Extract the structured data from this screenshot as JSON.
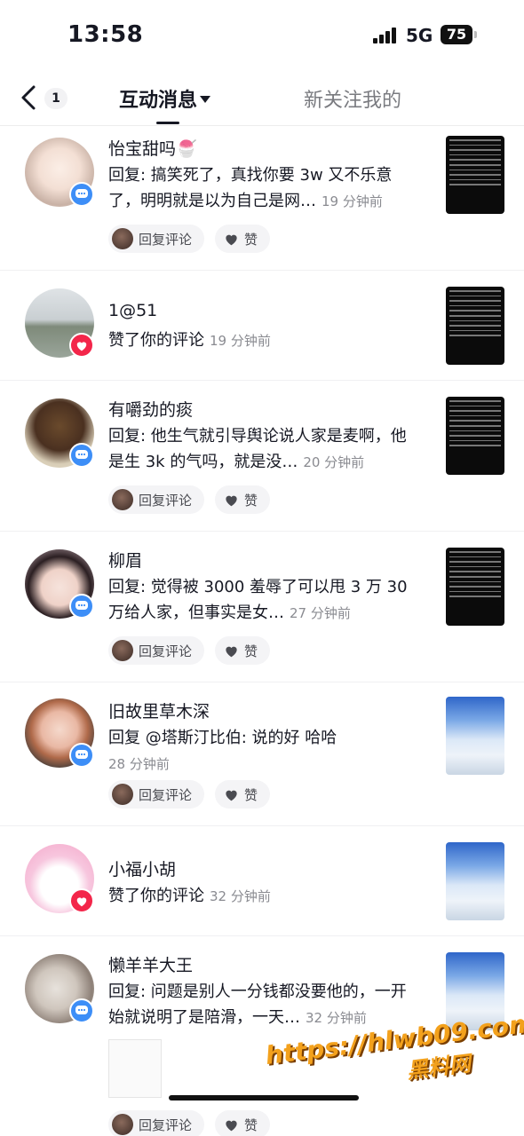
{
  "status": {
    "time": "13:58",
    "network": "5G",
    "battery": "75"
  },
  "header": {
    "back_count": "1",
    "tabs": [
      {
        "label": "互动消息"
      },
      {
        "label": "新关注我的"
      }
    ]
  },
  "feed": [
    {
      "name": "怡宝甜吗🍧",
      "badge": "comment-icon",
      "text": "回复: 搞笑死了，真找你要 3w 又不乐意了，明明就是以为自己是网…",
      "time": "19 分钟前",
      "reply_label": "回复评论",
      "like_label": "赞",
      "thumb": "black"
    },
    {
      "name": "1@51",
      "badge": "heart-icon",
      "text": "赞了你的评论",
      "time": "19 分钟前",
      "thumb": "black"
    },
    {
      "name": "有嚼劲的痰",
      "badge": "comment-icon",
      "text": "回复: 他生气就引导舆论说人家是麦啊，他是生 3k 的气吗，就是没…",
      "time": "20 分钟前",
      "reply_label": "回复评论",
      "like_label": "赞",
      "thumb": "black"
    },
    {
      "name": "柳眉",
      "badge": "comment-icon",
      "text": "回复: 觉得被 3000 羞辱了可以甩 3 万 30 万给人家，但事实是女…",
      "time": "27 分钟前",
      "reply_label": "回复评论",
      "like_label": "赞",
      "thumb": "black"
    },
    {
      "name": "旧故里草木深",
      "badge": "comment-icon",
      "text": "回复 @塔斯汀比伯: 说的好 哈哈",
      "time": "28 分钟前",
      "reply_label": "回复评论",
      "like_label": "赞",
      "thumb": "snow"
    },
    {
      "name": "小福小胡",
      "badge": "heart-icon",
      "text": "赞了你的评论",
      "time": "32 分钟前",
      "thumb": "snow"
    },
    {
      "name": "懒羊羊大王",
      "badge": "comment-icon",
      "text": "回复: 问题是别人一分钱都没要他的，一开始就说明了是陪滑，一天…",
      "time": "32 分钟前",
      "reply_label": "回复评论",
      "like_label": "赞",
      "thumb": "snow"
    }
  ],
  "watermark": {
    "url": "https://hlwb09.com",
    "label": "黑料网"
  },
  "colors": {
    "comment_badge": "#3d8ef7",
    "like_badge": "#f3264a",
    "watermark": "#f3a11c"
  }
}
